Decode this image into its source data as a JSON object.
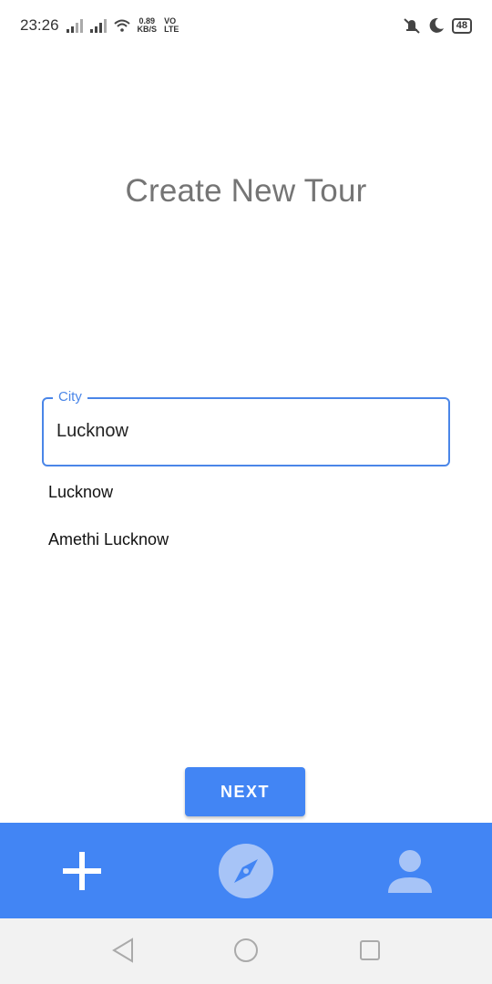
{
  "status_bar": {
    "time": "23:26",
    "net_speed_value": "0.89",
    "net_speed_unit": "KB/S",
    "volte_top": "VO",
    "volte_bottom": "LTE",
    "battery": "48"
  },
  "page": {
    "title": "Create New Tour"
  },
  "city_field": {
    "label": "City",
    "value": "Lucknow"
  },
  "suggestions": [
    "Lucknow",
    "Amethi Lucknow"
  ],
  "next_button": {
    "label": "NEXT"
  },
  "bottom_nav": {
    "items": [
      {
        "icon": "plus-icon"
      },
      {
        "icon": "compass-icon"
      },
      {
        "icon": "person-icon"
      }
    ]
  },
  "system_nav": {
    "items": [
      {
        "icon": "back-triangle-icon"
      },
      {
        "icon": "home-circle-icon"
      },
      {
        "icon": "recents-square-icon"
      }
    ]
  },
  "colors": {
    "accent": "#4285f4",
    "field_border": "#4a86e8",
    "title": "#757575"
  }
}
